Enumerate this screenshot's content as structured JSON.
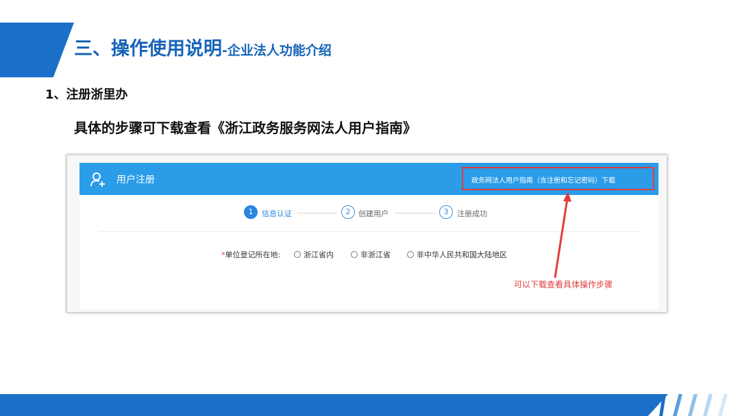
{
  "slide": {
    "title": "三、操作使用说明",
    "subtitle": "-企业法人功能介绍",
    "section_heading": "1、注册浙里办",
    "section_desc": "具体的步骤可下载查看《浙江政务服务网法人用户指南》"
  },
  "registration": {
    "title": "用户注册",
    "guide_link": "政务网法人用户指南（含注册和忘记密码）下载",
    "steps": [
      {
        "number": "1",
        "label": "信息认证",
        "active": true
      },
      {
        "number": "2",
        "label": "创建用户",
        "active": false
      },
      {
        "number": "3",
        "label": "注册成功",
        "active": false
      }
    ],
    "location_field": {
      "required_mark": "*",
      "label": "单位登记所在地:",
      "options": [
        "浙江省内",
        "非浙江省",
        "非中华人民共和国大陆地区"
      ]
    }
  },
  "annotation": "可以下载查看具体操作步骤",
  "colors": {
    "brand_blue": "#1a6fc8",
    "header_blue": "#2a9ce8",
    "highlight_red": "#e23b3b"
  },
  "icons": {
    "user": "user-add-icon",
    "arrow": "arrow-icon"
  }
}
